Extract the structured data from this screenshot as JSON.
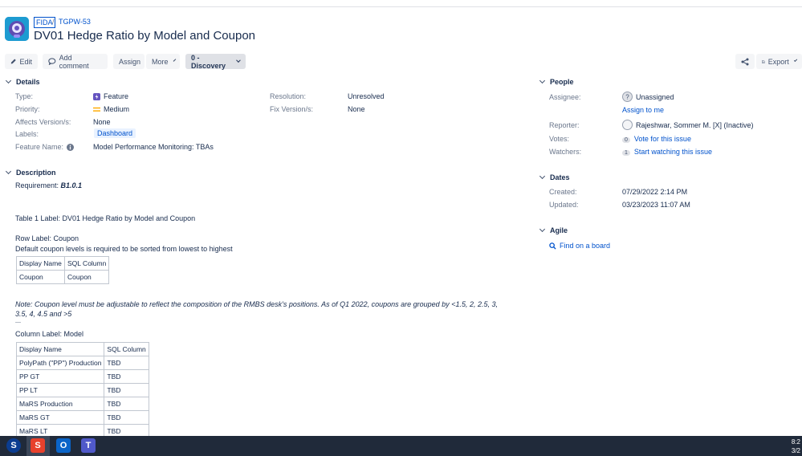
{
  "breadcrumb": {
    "project": "FIDA",
    "separator": "/",
    "issue_key": "TGPW-53"
  },
  "issue": {
    "title": "DV01 Hedge Ratio by Model and Coupon"
  },
  "toolbar": {
    "edit": "Edit",
    "add_comment": "Add comment",
    "assign": "Assign",
    "more": "More",
    "status": "0 - Discovery",
    "export": "Export"
  },
  "details": {
    "heading": "Details",
    "type_label": "Type:",
    "type_value": "Feature",
    "priority_label": "Priority:",
    "priority_value": "Medium",
    "affects_label": "Affects Version/s:",
    "affects_value": "None",
    "labels_label": "Labels:",
    "labels_value": "Dashboard",
    "feature_name_label": "Feature Name:",
    "feature_name_value": "Model Performance Monitoring: TBAs",
    "resolution_label": "Resolution:",
    "resolution_value": "Unresolved",
    "fix_label": "Fix Version/s:",
    "fix_value": "None"
  },
  "description": {
    "heading": "Description",
    "requirement_label": "Requirement:",
    "requirement_value": "B1.0.1",
    "table1_label": "Table 1 Label:  DV01 Hedge Ratio by Model and Coupon",
    "row_label": "Row Label: Coupon",
    "row_note": "Default coupon levels is required to be sorted from lowest to highest",
    "table_a": {
      "headers": [
        "Display Name",
        "SQL Column"
      ],
      "rows": [
        [
          "Coupon",
          "Coupon"
        ]
      ]
    },
    "note": "Note: Coupon level must be adjustable to reflect the composition of the RMBS desk's positions. As of Q1 2022, coupons are grouped by <1.5, 2, 2.5, 3, 3.5, 4, 4.5 and >5",
    "dash": "—",
    "column_label": "Column Label: Model",
    "table_b": {
      "headers": [
        "Display Name",
        "SQL Column"
      ],
      "rows": [
        [
          "PolyPath (\"PP\") Production",
          "TBD"
        ],
        [
          "PP GT",
          "TBD"
        ],
        [
          "PP LT",
          "TBD"
        ],
        [
          "MaRS Production",
          "TBD"
        ],
        [
          "MaRS GT",
          "TBD"
        ],
        [
          "MaRS LT",
          "TBD"
        ]
      ]
    }
  },
  "people": {
    "heading": "People",
    "assignee_label": "Assignee:",
    "assignee_value": "Unassigned",
    "assign_to_me": "Assign to me",
    "reporter_label": "Reporter:",
    "reporter_value": "Rajeshwar, Sommer M. [X] (Inactive)",
    "votes_label": "Votes:",
    "votes_count": "0",
    "votes_link": "Vote for this issue",
    "watchers_label": "Watchers:",
    "watchers_count": "1",
    "watchers_link": "Start watching this issue"
  },
  "dates": {
    "heading": "Dates",
    "created_label": "Created:",
    "created_value": "07/29/2022 2:14 PM",
    "updated_label": "Updated:",
    "updated_value": "03/23/2023 11:07 AM"
  },
  "agile": {
    "heading": "Agile",
    "find_board": "Find on a board"
  },
  "taskbar": {
    "clock_time": "8:2",
    "clock_date": "3/2"
  },
  "colors": {
    "link": "#0052cc",
    "text": "#172b4d",
    "muted": "#6b778c",
    "feature": "#6554c0",
    "medium": "#ffab00",
    "taskbar": "#202a3a"
  },
  "icons": [
    "project-avatar-icon",
    "pencil-icon",
    "comment-icon",
    "share-icon",
    "export-icon",
    "feature-icon",
    "priority-medium-icon",
    "info-icon",
    "unassigned-avatar-icon",
    "user-avatar-icon",
    "search-icon",
    "skype-icon",
    "snagit-icon",
    "outlook-icon",
    "teams-icon"
  ]
}
